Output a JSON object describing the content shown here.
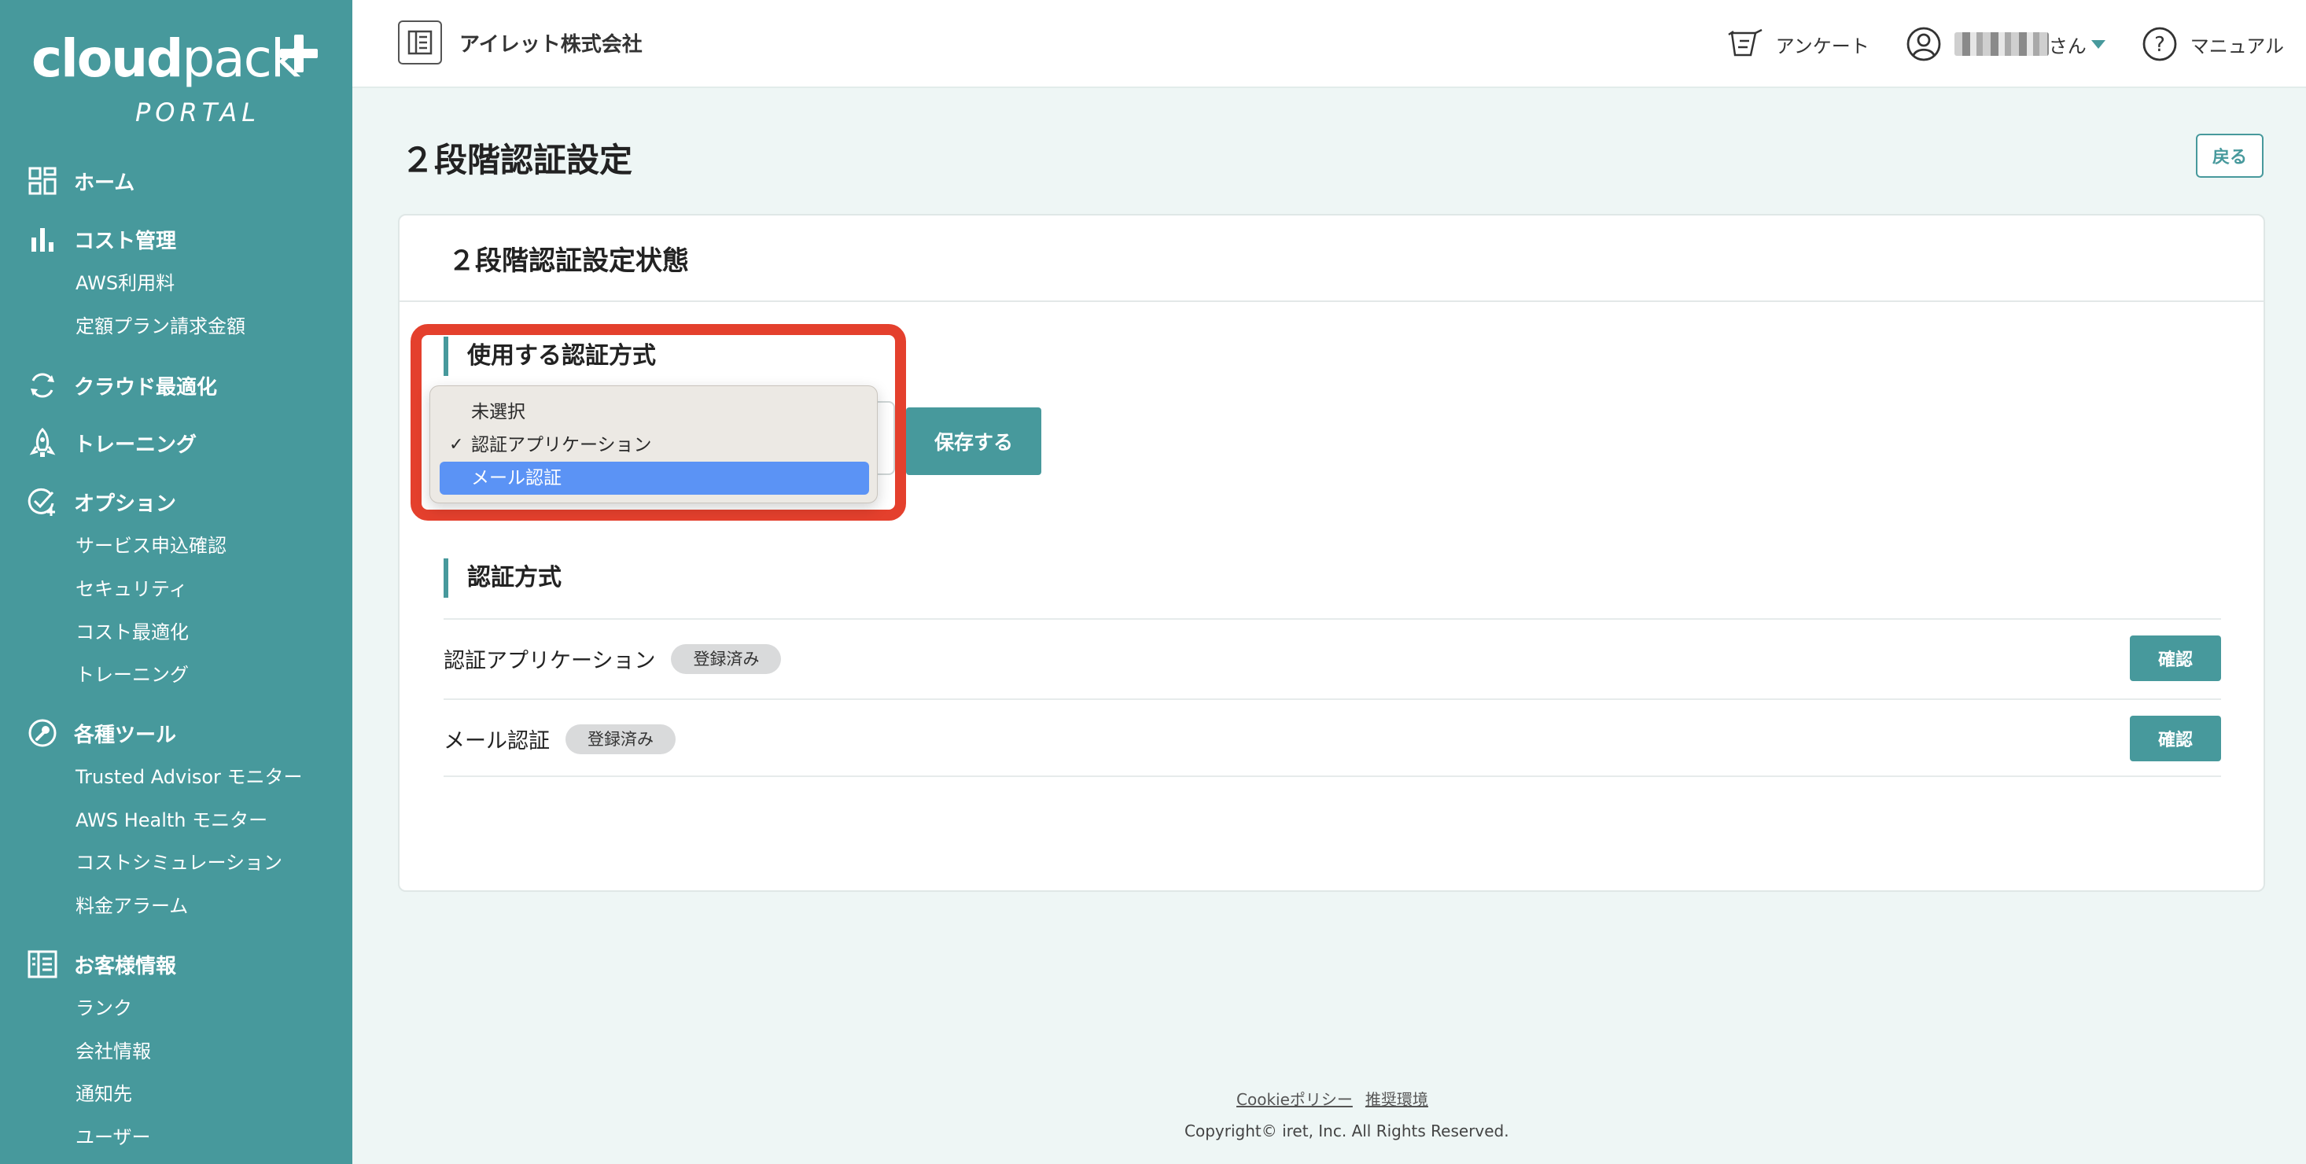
{
  "brand": {
    "name_bold": "cloud",
    "name_light": "pack",
    "sub": "PORTAL"
  },
  "sidebar": {
    "sections": [
      {
        "label": "ホーム",
        "icon": "grid-icon",
        "items": []
      },
      {
        "label": "コスト管理",
        "icon": "bar-chart-icon",
        "items": [
          "AWS利用料",
          "定額プラン請求金額"
        ]
      },
      {
        "label": "クラウド最適化",
        "icon": "refresh-icon",
        "items": []
      },
      {
        "label": "トレーニング",
        "icon": "rocket-icon",
        "items": []
      },
      {
        "label": "オプション",
        "icon": "check-plus-icon",
        "items": [
          "サービス申込確認",
          "セキュリティ",
          "コスト最適化",
          "トレーニング"
        ]
      },
      {
        "label": "各種ツール",
        "icon": "wrench-icon",
        "items": [
          "Trusted Advisor モニター",
          "AWS Health モニター",
          "コストシミュレーション",
          "料金アラーム"
        ]
      },
      {
        "label": "お客様情報",
        "icon": "building-icon",
        "items": [
          "ランク",
          "会社情報",
          "通知先",
          "ユーザー"
        ]
      }
    ]
  },
  "header": {
    "company": "アイレット株式会社",
    "survey": "アンケート",
    "user_suffix": "さん",
    "manual": "マニュアル"
  },
  "page": {
    "title": "２段階認証設定",
    "back": "戻る"
  },
  "card": {
    "title": "２段階認証設定状態",
    "method_section": "使用する認証方式",
    "options": [
      "未選択",
      "認証アプリケーション",
      "メール認証"
    ],
    "checked_option": "認証アプリケーション",
    "highlighted_option": "メール認証",
    "save": "保存する",
    "registered_section": "認証方式",
    "methods": [
      {
        "name": "認証アプリケーション",
        "status": "登録済み",
        "action": "確認"
      },
      {
        "name": "メール認証",
        "status": "登録済み",
        "action": "確認"
      }
    ]
  },
  "footer": {
    "links": [
      "Cookieポリシー",
      "推奨環境"
    ],
    "copyright": "Copyright© iret, Inc. All Rights Reserved."
  },
  "colors": {
    "accent": "#47999c",
    "highlight": "#e4402d",
    "selected": "#5b93f5"
  }
}
